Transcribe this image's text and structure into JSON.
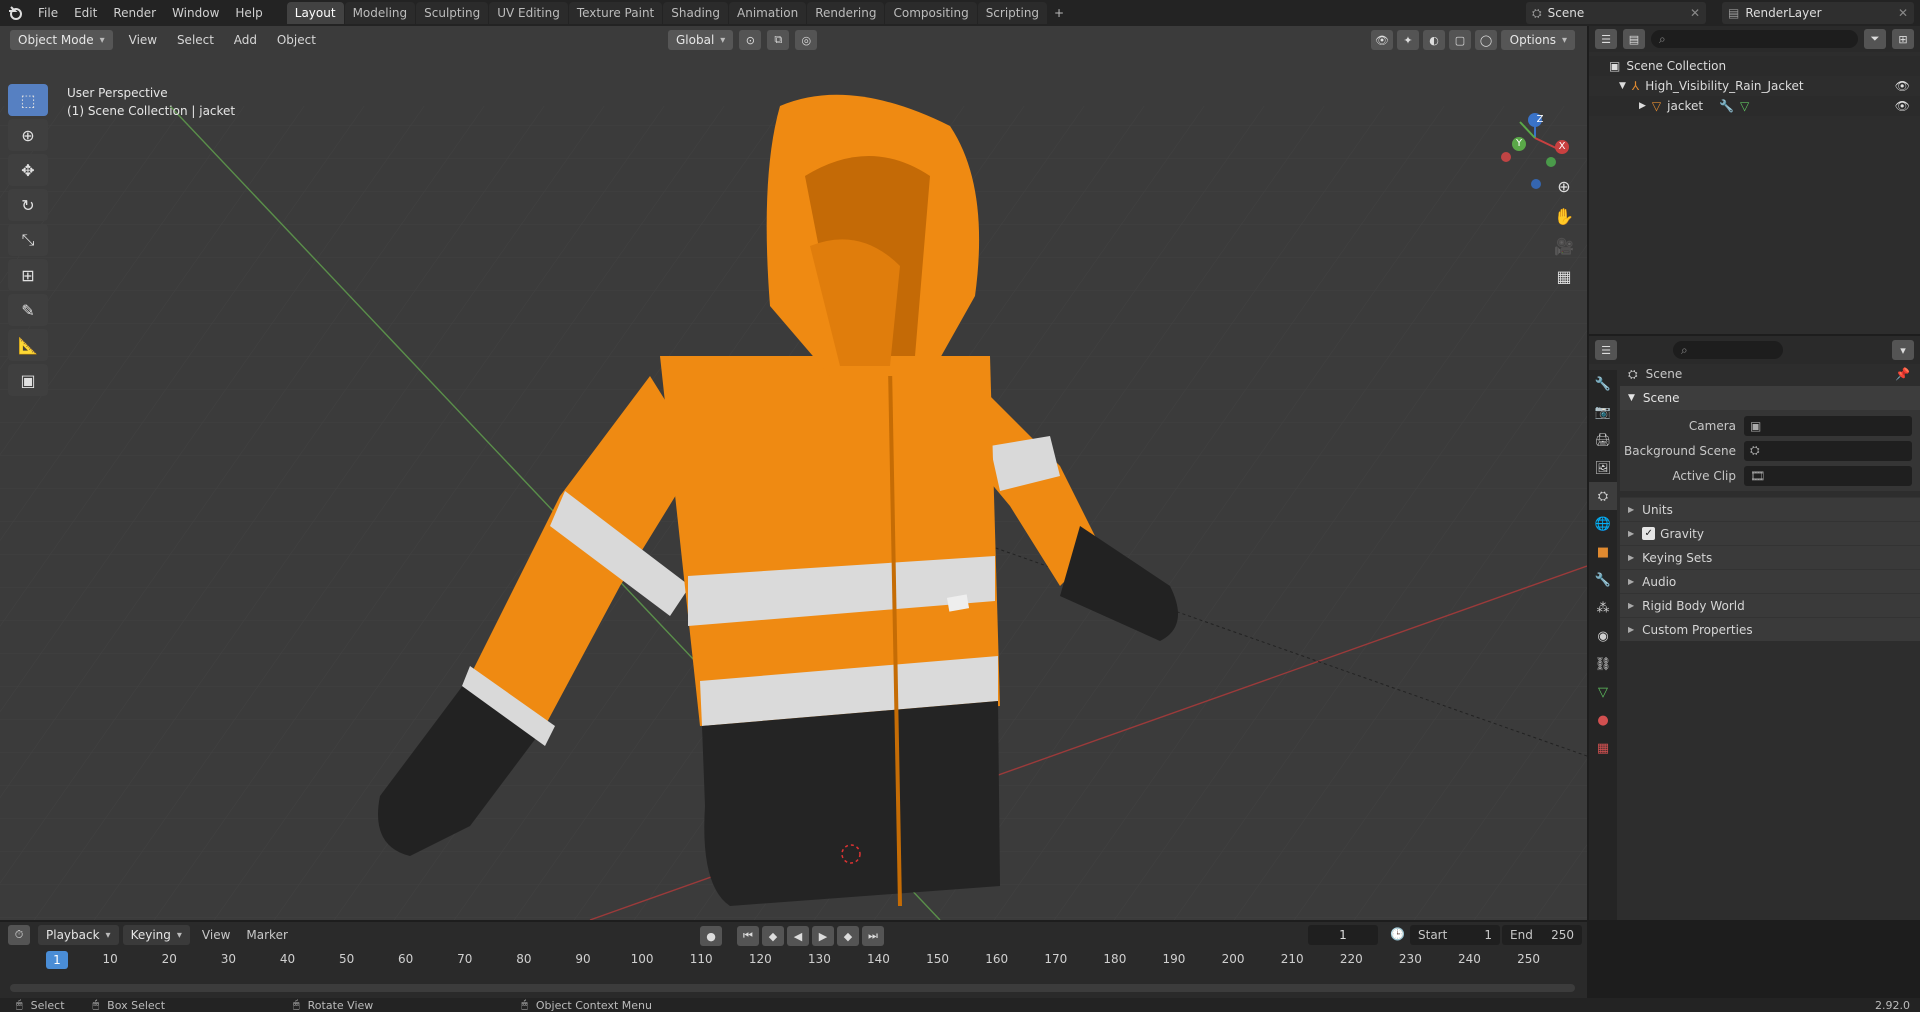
{
  "menu": [
    "File",
    "Edit",
    "Render",
    "Window",
    "Help"
  ],
  "workspaces": [
    {
      "label": "Layout",
      "active": true
    },
    {
      "label": "Modeling"
    },
    {
      "label": "Sculpting"
    },
    {
      "label": "UV Editing"
    },
    {
      "label": "Texture Paint"
    },
    {
      "label": "Shading"
    },
    {
      "label": "Animation"
    },
    {
      "label": "Rendering"
    },
    {
      "label": "Compositing"
    },
    {
      "label": "Scripting"
    }
  ],
  "scene_name": "Scene",
  "view_layer": "RenderLayer",
  "viewport": {
    "mode": "Object Mode",
    "menu": [
      "View",
      "Select",
      "Add",
      "Object"
    ],
    "orientation": "Global",
    "options": "Options",
    "perspective": "User Perspective",
    "collection_info": "(1) Scene Collection | jacket",
    "gizmo": {
      "x": "X",
      "y": "Y",
      "z": "Z"
    }
  },
  "outliner": {
    "root": "Scene Collection",
    "items": [
      {
        "label": "High_Visibility_Rain_Jacket"
      },
      {
        "label": "jacket"
      }
    ]
  },
  "properties": {
    "header": "Scene",
    "section": "Scene",
    "fields": [
      {
        "label": "Camera"
      },
      {
        "label": "Background Scene"
      },
      {
        "label": "Active Clip"
      }
    ],
    "panels": [
      "Units",
      "Gravity",
      "Keying Sets",
      "Audio",
      "Rigid Body World",
      "Custom Properties"
    ]
  },
  "timeline": {
    "menu": [
      "Playback",
      "Keying",
      "View",
      "Marker"
    ],
    "current": "1",
    "start_label": "Start",
    "start": "1",
    "end_label": "End",
    "end": "250",
    "ticks": [
      "10",
      "20",
      "30",
      "40",
      "50",
      "60",
      "70",
      "80",
      "90",
      "100",
      "110",
      "120",
      "130",
      "140",
      "150",
      "160",
      "170",
      "180",
      "190",
      "200",
      "210",
      "220",
      "230",
      "240",
      "250"
    ],
    "cur_tick": "1"
  },
  "status": {
    "select": "Select",
    "box": "Box Select",
    "rotate": "Rotate View",
    "ctx": "Object Context Menu",
    "version": "2.92.0"
  },
  "colors": {
    "accent": "#4a8dd6",
    "jacket": "#f08a12",
    "reflective": "#d8d8d8",
    "dark": "#232323"
  }
}
